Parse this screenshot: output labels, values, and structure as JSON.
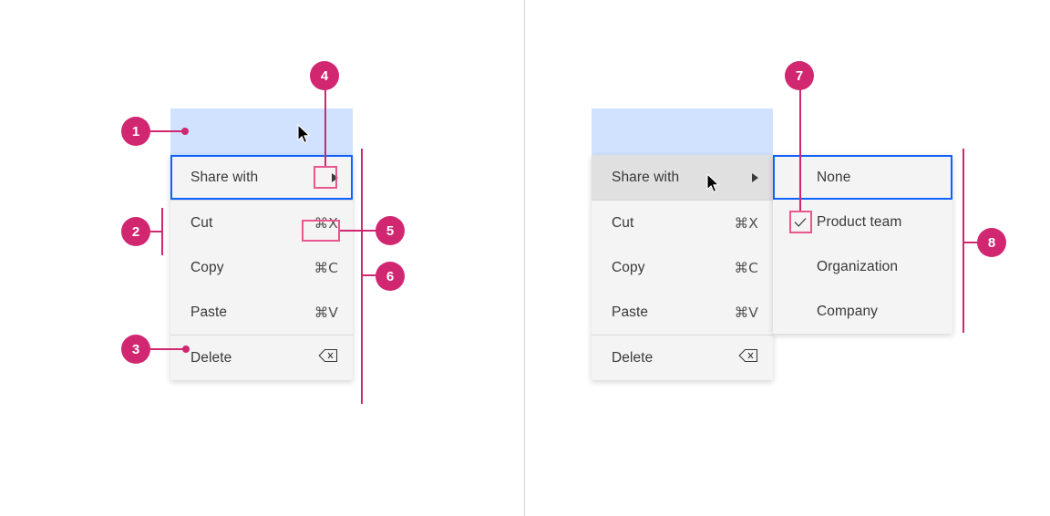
{
  "page": {
    "background_color": "#ffffff",
    "divider_color": "#d9d9d9",
    "annotation_color": "#d12771",
    "annotation_box_color": "#e8578f",
    "focus_color": "#0f62fe",
    "selection_color": "#d0e2ff",
    "menu_bg_color": "#f4f4f4",
    "menu_hover_color": "#e0e0e0"
  },
  "left_example": {
    "name": "context-menu-closed-submenu",
    "menu": {
      "items": [
        {
          "label": "Share with",
          "shortcut": "",
          "has_submenu": true,
          "focused": true,
          "hovered": false
        },
        {
          "label": "Cut",
          "shortcut": "⌘X",
          "has_submenu": false,
          "focused": false,
          "hovered": false
        },
        {
          "label": "Copy",
          "shortcut": "⌘C",
          "has_submenu": false,
          "focused": false,
          "hovered": false
        },
        {
          "label": "Paste",
          "shortcut": "⌘V",
          "has_submenu": false,
          "focused": false,
          "hovered": false
        },
        {
          "label": "Delete",
          "shortcut": "⌫",
          "has_submenu": false,
          "focused": false,
          "hovered": false
        }
      ]
    }
  },
  "right_example": {
    "name": "context-menu-open-submenu",
    "menu": {
      "items": [
        {
          "label": "Share with",
          "shortcut": "",
          "has_submenu": true,
          "focused": false,
          "hovered": true
        },
        {
          "label": "Cut",
          "shortcut": "⌘X",
          "has_submenu": false,
          "focused": false,
          "hovered": false
        },
        {
          "label": "Copy",
          "shortcut": "⌘C",
          "has_submenu": false,
          "focused": false,
          "hovered": false
        },
        {
          "label": "Paste",
          "shortcut": "⌘V",
          "has_submenu": false,
          "focused": false,
          "hovered": false
        },
        {
          "label": "Delete",
          "shortcut": "⌫",
          "has_submenu": false,
          "focused": false,
          "hovered": false
        }
      ]
    },
    "submenu": {
      "items": [
        {
          "label": "None",
          "checked": false,
          "focused": true
        },
        {
          "label": "Product team",
          "checked": true,
          "focused": false
        },
        {
          "label": "Organization",
          "checked": false,
          "focused": false
        },
        {
          "label": "Company",
          "checked": false,
          "focused": false
        }
      ]
    }
  },
  "annotations": [
    {
      "number": "1",
      "target": "selected-content-area"
    },
    {
      "number": "2",
      "target": "menu-item"
    },
    {
      "number": "3",
      "target": "menu-divider"
    },
    {
      "number": "4",
      "target": "submenu-caret-icon"
    },
    {
      "number": "5",
      "target": "keyboard-shortcut"
    },
    {
      "number": "6",
      "target": "menu-container"
    },
    {
      "number": "7",
      "target": "selection-checkmark-icon"
    },
    {
      "number": "8",
      "target": "submenu-container"
    }
  ]
}
